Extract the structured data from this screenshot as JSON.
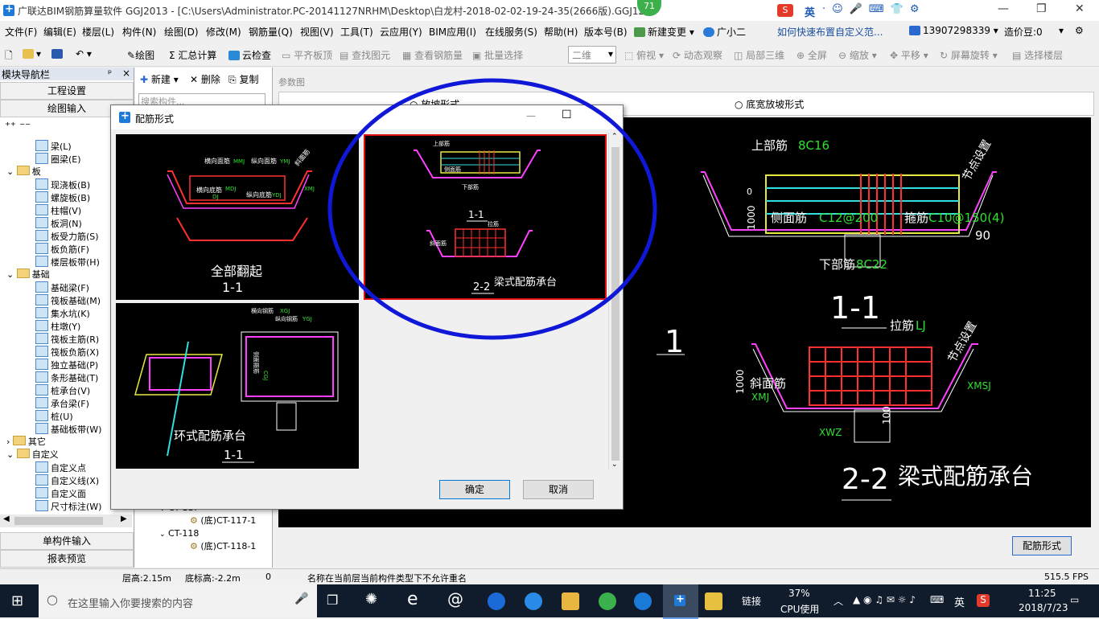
{
  "window": {
    "title": "广联达BIM钢筋算量软件 GGJ2013 - [C:\\Users\\Administrator.PC-20141127NRHM\\Desktop\\白龙村-2018-02-02-19-24-35(2666版).GGJ12]",
    "badge": "71",
    "ime_label": "英",
    "minimize": "—",
    "maximize": "❐",
    "close": "✕"
  },
  "menu": {
    "items": [
      "文件(F)",
      "编辑(E)",
      "楼层(L)",
      "构件(N)",
      "绘图(D)",
      "修改(M)",
      "钢筋量(Q)",
      "视图(V)",
      "工具(T)",
      "云应用(Y)",
      "BIM应用(I)",
      "在线服务(S)",
      "帮助(H)",
      "版本号(B)"
    ],
    "new_change": "新建变更",
    "assistant": "广小二",
    "help_link": "如何快速布置自定义范...",
    "phone": "13907298339",
    "price_bean": "造价豆:0"
  },
  "toolbar": {
    "draw": "绘图",
    "sum_calc": "汇总计算",
    "cloud_check": "云检查",
    "flat_slab_top": "平齐板顶",
    "find_element": "查找图元",
    "view_rebar": "查看钢筋量",
    "batch_select": "批量选择",
    "view_mode": "二维",
    "top_view": "俯视",
    "dynamic_view": "动态观察",
    "local_3d": "局部三维",
    "full_screen": "全屏",
    "zoom": "缩放",
    "pan": "平移",
    "screen_rotate": "屏幕旋转",
    "select_floor": "选择楼层"
  },
  "left_nav": {
    "title": "模块导航栏",
    "project_settings": "工程设置",
    "drawing_input": "绘图输入",
    "tree": [
      {
        "label": "梁(L)",
        "level": 2,
        "type": "item"
      },
      {
        "label": "圈梁(E)",
        "level": 2,
        "type": "item"
      },
      {
        "label": "板",
        "level": 1,
        "type": "folder"
      },
      {
        "label": "现浇板(B)",
        "level": 2,
        "type": "item"
      },
      {
        "label": "螺旋板(B)",
        "level": 2,
        "type": "item"
      },
      {
        "label": "柱帽(V)",
        "level": 2,
        "type": "item"
      },
      {
        "label": "板洞(N)",
        "level": 2,
        "type": "item"
      },
      {
        "label": "板受力筋(S)",
        "level": 2,
        "type": "item"
      },
      {
        "label": "板负筋(F)",
        "level": 2,
        "type": "item"
      },
      {
        "label": "楼层板带(H)",
        "level": 2,
        "type": "item"
      },
      {
        "label": "基础",
        "level": 1,
        "type": "folder"
      },
      {
        "label": "基础梁(F)",
        "level": 2,
        "type": "item"
      },
      {
        "label": "筏板基础(M)",
        "level": 2,
        "type": "item"
      },
      {
        "label": "集水坑(K)",
        "level": 2,
        "type": "item"
      },
      {
        "label": "柱墩(Y)",
        "level": 2,
        "type": "item"
      },
      {
        "label": "筏板主筋(R)",
        "level": 2,
        "type": "item"
      },
      {
        "label": "筏板负筋(X)",
        "level": 2,
        "type": "item"
      },
      {
        "label": "独立基础(P)",
        "level": 2,
        "type": "item"
      },
      {
        "label": "条形基础(T)",
        "level": 2,
        "type": "item"
      },
      {
        "label": "桩承台(V)",
        "level": 2,
        "type": "item"
      },
      {
        "label": "承台梁(F)",
        "level": 2,
        "type": "item"
      },
      {
        "label": "桩(U)",
        "level": 2,
        "type": "item"
      },
      {
        "label": "基础板带(W)",
        "level": 2,
        "type": "item"
      },
      {
        "label": "其它",
        "level": 1,
        "type": "folder"
      },
      {
        "label": "自定义",
        "level": 1,
        "type": "folder"
      },
      {
        "label": "自定义点",
        "level": 2,
        "type": "item"
      },
      {
        "label": "自定义线(X)",
        "level": 2,
        "type": "item"
      },
      {
        "label": "自定义面",
        "level": 2,
        "type": "item"
      },
      {
        "label": "尺寸标注(W)",
        "level": 2,
        "type": "item"
      }
    ],
    "single_input": "单构件输入",
    "report_preview": "报表预览"
  },
  "mid_panel": {
    "new": "新建",
    "delete": "删除",
    "copy": "复制",
    "search_placeholder": "搜索构件...",
    "tree": [
      {
        "label": "CT-117",
        "level": 1
      },
      {
        "label": "(底)CT-117-1",
        "level": 2
      },
      {
        "label": "CT-118",
        "level": 1
      },
      {
        "label": "(底)CT-118-1",
        "level": 2
      }
    ]
  },
  "param_panel": {
    "title": "参数图",
    "radio_1": "放坡形式",
    "radio_2": "底宽放坡形式",
    "rebar_form_button": "配筋形式",
    "drawing": {
      "top_rebar": "上部筋",
      "top_rebar_val": "8C16",
      "node_setting": "节点设置",
      "side_rebar": "侧面筋",
      "side_rebar_val": "C12@200",
      "stirrup": "箍筋",
      "stirrup_val": "C10@150(4)",
      "bottom_rebar": "下部筋",
      "bottom_rebar_val": "8C22",
      "angle": "90",
      "section_1": "1-1",
      "big_number": "1",
      "tie_bar": "拉筋",
      "tie_bar_val": "LJ",
      "slope_rebar": "斜面筋",
      "slope_rebar_code": "XMJ",
      "xmsj": "XMSJ",
      "xwz": "XWZ",
      "dim_1000": "1000",
      "dim_100": "100",
      "dim_1000b": "1000",
      "dim_0": "0",
      "section_2": "2-2",
      "caption": "梁式配筋承台"
    }
  },
  "dialog": {
    "title": "配筋形式",
    "minimize": "—",
    "maximize": "☐",
    "options": [
      {
        "caption": "全部翻起",
        "section": "1-1",
        "labels": [
          "横向面筋",
          "纵向面筋",
          "横向底筋",
          "纵向底筋",
          "斜面筋",
          "MMJ",
          "MDJ",
          "YMJ",
          "YDJ",
          "XMJ",
          "DJ"
        ]
      },
      {
        "caption": "梁式配筋承台",
        "section": "2-2",
        "section_top": "1-1",
        "selected": true,
        "labels": [
          "上部筋",
          "侧面筋",
          "下部筋",
          "拉筋",
          "斜面筋"
        ]
      },
      {
        "caption": "环式配筋承台",
        "section": "1-1",
        "labels": [
          "横向钢筋",
          "纵向钢筋",
          "XGJ",
          "YGJ",
          "侧面箍筋",
          "CGJ"
        ]
      }
    ],
    "ok": "确定",
    "cancel": "取消"
  },
  "status": {
    "floor_height": "层高:2.15m",
    "base_height": "底标高:-2.2m",
    "zero": "0",
    "message": "名称在当前层当前构件类型下不允许重名",
    "fps": "515.5 FPS"
  },
  "taskbar": {
    "search_placeholder": "在这里输入你要搜索的内容",
    "link": "链接",
    "cpu_percent": "37%",
    "cpu_label": "CPU使用",
    "ime": "英",
    "time": "11:25",
    "date": "2018/7/23"
  },
  "colors": {
    "selection_circle": "#1018d8",
    "selected_border": "#e01010",
    "cad_background": "#000000",
    "taskbar": "#101c2c"
  }
}
